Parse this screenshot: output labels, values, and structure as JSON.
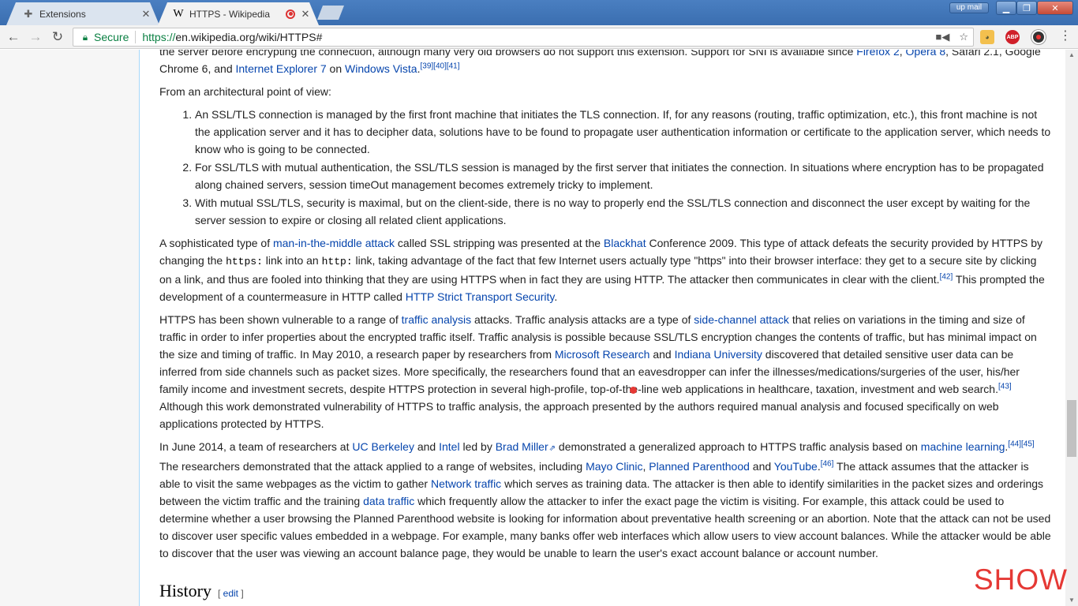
{
  "browser": {
    "tabs": [
      {
        "title": "Extensions",
        "icon": "puzzle-icon",
        "active": false
      },
      {
        "title": "HTTPS - Wikipedia",
        "icon": "wikipedia-w-icon",
        "active": true
      }
    ],
    "window_user": "up mail",
    "secure_label": "Secure",
    "url_scheme": "https://",
    "url_rest": "en.wikipedia.org/wiki/HTTPS#",
    "extensions": [
      "honey-icon",
      "adblock-plus-icon",
      "record-icon"
    ]
  },
  "article": {
    "p_top": {
      "t1": "the server before encrypting the connection, although many very old browsers do not support this extension. Support for SNI is available since ",
      "l1": "Firefox 2",
      "t2": ", ",
      "l2": "Opera 8",
      "t3": ", Safari 2.1, Google Chrome 6, and ",
      "l3": "Internet Explorer 7",
      "t4": " on ",
      "l4": "Windows Vista",
      "t5": ".",
      "refs": "[39][40][41]"
    },
    "arch_intro": "From an architectural point of view:",
    "arch_list": [
      "An SSL/TLS connection is managed by the first front machine that initiates the TLS connection. If, for any reasons (routing, traffic optimization, etc.), this front machine is not the application server and it has to decipher data, solutions have to be found to propagate user authentication information or certificate to the application server, which needs to know who is going to be connected.",
      "For SSL/TLS with mutual authentication, the SSL/TLS session is managed by the first server that initiates the connection. In situations where encryption has to be propagated along chained servers, session timeOut management becomes extremely tricky to implement.",
      "With mutual SSL/TLS, security is maximal, but on the client-side, there is no way to properly end the SSL/TLS connection and disconnect the user except by waiting for the server session to expire or closing all related client applications."
    ],
    "p_mitm": {
      "t1": "A sophisticated type of ",
      "l1": "man-in-the-middle attack",
      "t2": " called SSL stripping was presented at the ",
      "l2": "Blackhat",
      "t3": " Conference 2009. This type of attack defeats the security provided by HTTPS by changing the ",
      "c1": "https:",
      "t4": " link into an ",
      "c2": "http:",
      "t5": " link, taking advantage of the fact that few Internet users actually type \"https\" into their browser interface: they get to a secure site by clicking on a link, and thus are fooled into thinking that they are using HTTPS when in fact they are using HTTP. The attacker then communicates in clear with the client.",
      "ref": "[42]",
      "t6": " This prompted the development of a countermeasure in HTTP called ",
      "l3": "HTTP Strict Transport Security",
      "t7": "."
    },
    "p_traffic": {
      "t1": "HTTPS has been shown vulnerable to a range of ",
      "l1": "traffic analysis",
      "t2": " attacks. Traffic analysis attacks are a type of ",
      "l2": "side-channel attack",
      "t3": " that relies on variations in the timing and size of traffic in order to infer properties about the encrypted traffic itself. Traffic analysis is possible because SSL/TLS encryption changes the contents of traffic, but has minimal impact on the size and timing of traffic. In May 2010, a research paper by researchers from ",
      "l3": "Microsoft Research",
      "t4": " and ",
      "l4": "Indiana University",
      "t5": " discovered that detailed sensitive user data can be inferred from side channels such as packet sizes. More specifically, the researchers found that an eavesdropper can infer the illnesses/medications/surgeries of the user, his/her family income and investment secrets, despite HTTPS protection in several high-profile, top-of-the-line web applications in healthcare, taxation, investment and web search.",
      "ref": "[43]",
      "t6": " Although this work demonstrated vulnerability of HTTPS to traffic analysis, the approach presented by the authors required manual analysis and focused specifically on web applications protected by HTTPS."
    },
    "p_2014": {
      "t1": "In June 2014, a team of researchers at ",
      "l1": "UC Berkeley",
      "t2": " and ",
      "l2": "Intel",
      "t3": " led by ",
      "l3": "Brad Miller",
      "t4": " demonstrated a generalized approach to HTTPS traffic analysis based on ",
      "l4": "machine learning",
      "t5": ".",
      "ref1": "[44][45]",
      "t6": " The researchers demonstrated that the attack applied to a range of websites, including ",
      "l5": "Mayo Clinic",
      "t7": ", ",
      "l6": "Planned Parenthood",
      "t8": " and ",
      "l7": "YouTube",
      "t9": ".",
      "ref2": "[46]",
      "t10": " The attack assumes that the attacker is able to visit the same webpages as the victim to gather ",
      "l8": "Network traffic",
      "t11": " which serves as training data. The attacker is then able to identify similarities in the packet sizes and orderings between the victim traffic and the training ",
      "l9": "data traffic",
      "t12": " which frequently allow the attacker to infer the exact page the victim is visiting. For example, this attack could be used to determine whether a user browsing the Planned Parenthood website is looking for information about preventative health screening or an abortion. Note that the attack can not be used to discover user specific values embedded in a webpage. For example, many banks offer web interfaces which allow users to view account balances. While the attacker would be able to discover that the user was viewing an account balance page, they would be unable to learn the user's exact account balance or account number."
    },
    "history_heading": "History",
    "edit_label": "edit"
  },
  "overlay": {
    "watermark": "SHOW"
  }
}
